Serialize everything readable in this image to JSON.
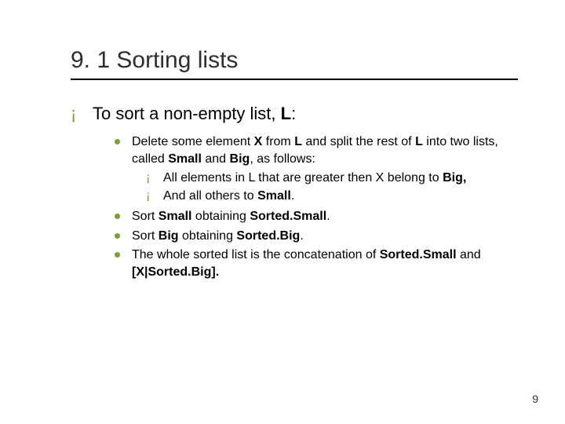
{
  "title": "9. 1 Sorting lists",
  "main_point": {
    "pre": "To sort a non-empty list, ",
    "bold": "L",
    "post": ": "
  },
  "steps": [
    {
      "html": "Delete some element <b>X</b> from <b>L</b> and split the rest of <b>L</b> into two lists, called <b>Small</b> and <b>Big</b>, as follows:",
      "sub": [
        "All elements in L that are greater then X belong to <b>Big,</b>",
        "And all others to <b>Small</b>."
      ]
    },
    {
      "html": "Sort <b>Small</b> obtaining <b>Sorted.Small</b>."
    },
    {
      "html": "Sort <b>Big</b> obtaining <b>Sorted.Big</b>."
    },
    {
      "html": "The whole sorted list is the concatenation of <b>Sorted.Small</b> and <b>[X|Sorted.Big].</b>"
    }
  ],
  "page_number": "9"
}
